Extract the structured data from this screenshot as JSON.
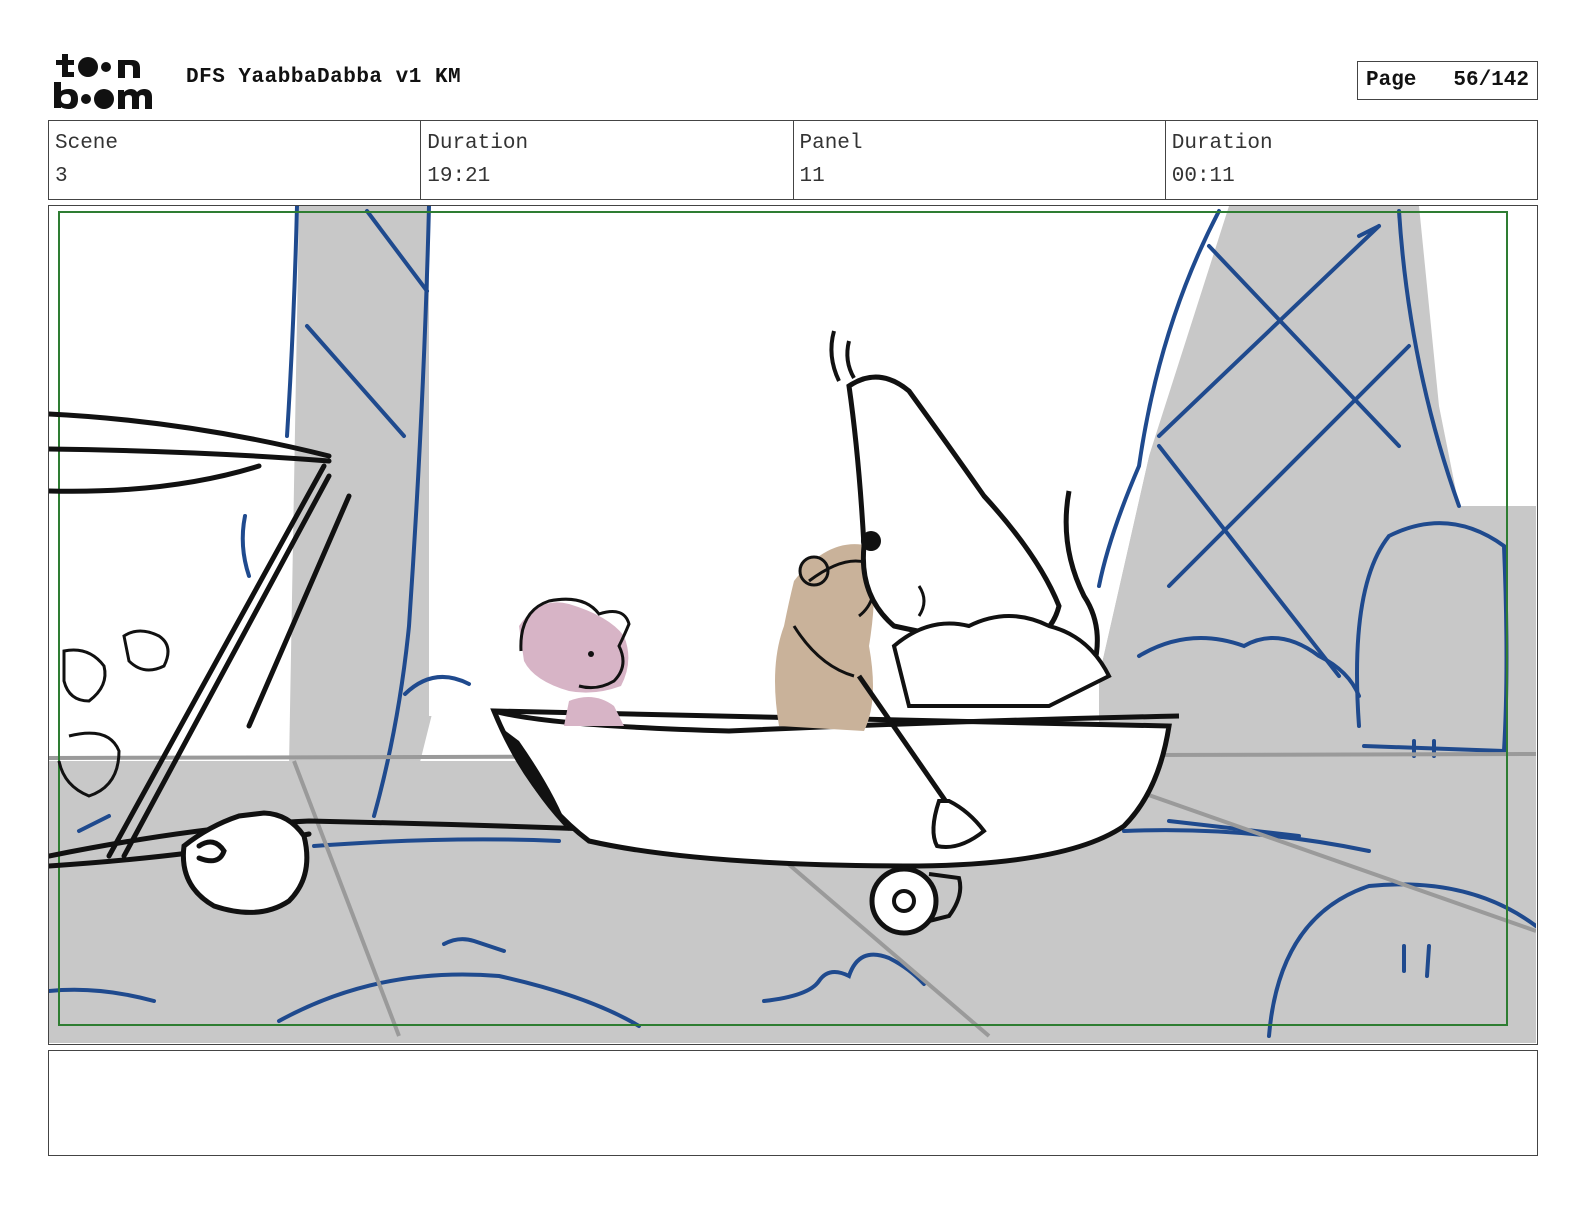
{
  "header": {
    "logo_text": "toonboom",
    "title": "DFS YaabbaDabba v1 KM",
    "page_label": "Page",
    "page_value": "56/142"
  },
  "info": {
    "scene_label": "Scene",
    "scene_value": "3",
    "scene_duration_label": "Duration",
    "scene_duration_value": "19:21",
    "panel_label": "Panel",
    "panel_value": "11",
    "panel_duration_label": "Duration",
    "panel_duration_value": "00:11"
  },
  "panel": {
    "description": "",
    "colors": {
      "gray": "#c8c8c8",
      "blue": "#1f4a8e",
      "safe_frame": "#2e7d32",
      "pink": "#d7b4c6",
      "tan": "#c9b29a",
      "ink": "#111111"
    }
  },
  "notes": {
    "text": ""
  }
}
